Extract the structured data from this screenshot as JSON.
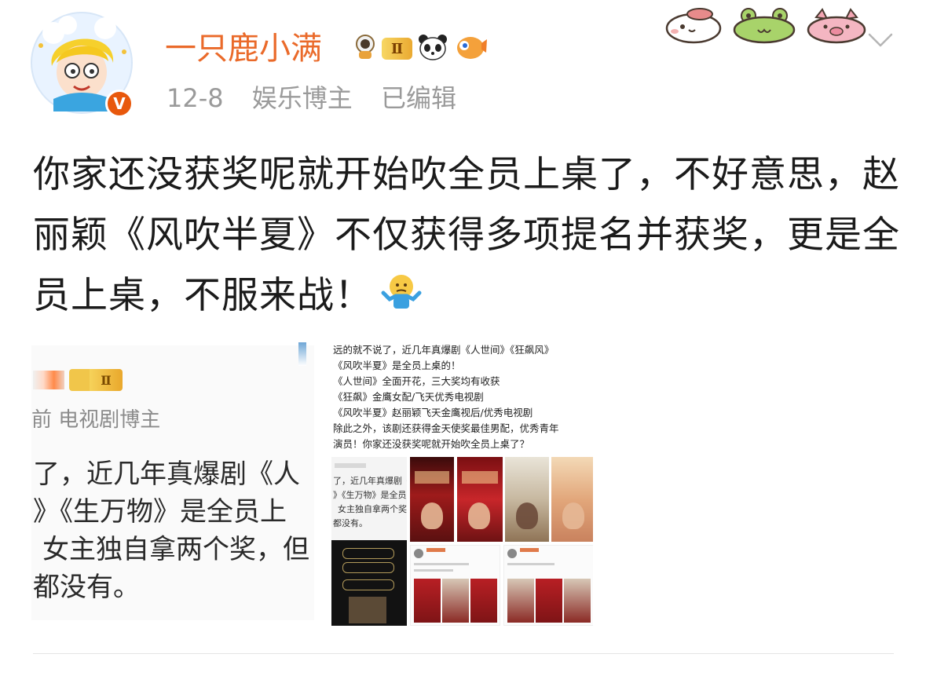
{
  "header": {
    "username": "一只鹿小满",
    "level_badge": "Ⅱ",
    "date": "12-8",
    "role": "娱乐博主",
    "edited": "已编辑",
    "verified_mark": "V"
  },
  "post": {
    "text": "你家还没获奖呢就开始吹全员上桌了，不好意思，赵丽颖《风吹半夏》不仅获得多项提名并获奖，更是全员上桌，不服来战！",
    "emoji": "shrug-emoji"
  },
  "left_card": {
    "level_badge": "Ⅱ",
    "subtitle": "前 电视剧博主",
    "lines": [
      "了，近几年真爆剧《人",
      "》《生万物》是全员上",
      "女主独自拿两个奖，但",
      "都没有。"
    ]
  },
  "screenshot": {
    "lines": [
      "远的就不说了，近几年真爆剧《人世间》《狂飙风》",
      "《风吹半夏》是全员上桌的！",
      "《人世间》全面开花，三大奖均有收获",
      "《狂飙》金鹰女配/飞天优秀电视剧",
      "《风吹半夏》赵丽颖飞天金鹰视后/优秀电视剧",
      "除此之外，该剧还获得金天使奖最佳男配，优秀青年",
      "演员！你家还没获奖呢就开始吹全员上桌了？"
    ],
    "inner_card": {
      "lines": [
        "了，近几年真爆剧《人",
        "》《生万物》是全员上",
        "女主独自拿两个奖，",
        "都没有。"
      ]
    }
  },
  "colors": {
    "username": "#ea6a2a",
    "meta": "#9a9a9a",
    "text": "#1b1b1b",
    "verified": "#e8580c"
  }
}
